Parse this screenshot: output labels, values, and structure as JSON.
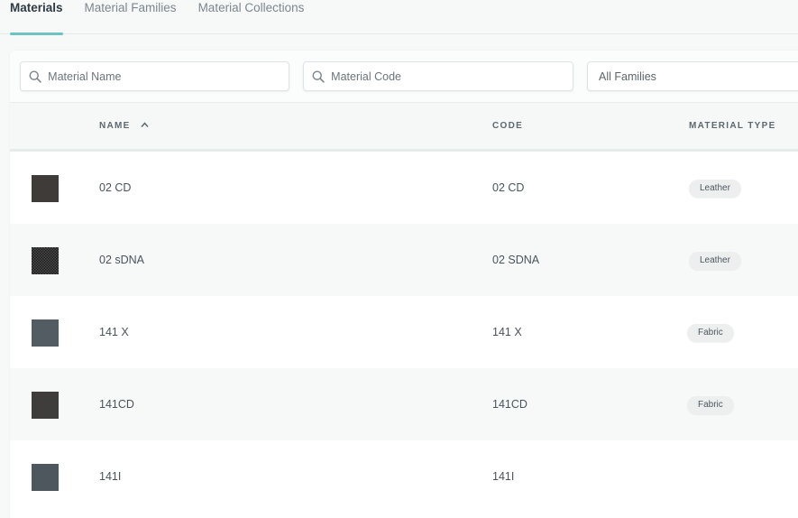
{
  "tabs": [
    {
      "label": "Materials",
      "active": true
    },
    {
      "label": "Material Families",
      "active": false
    },
    {
      "label": "Material Collections",
      "active": false
    }
  ],
  "filters": {
    "name_placeholder": "Material Name",
    "code_placeholder": "Material Code",
    "family_value": "All Families"
  },
  "columns": {
    "name": "NAME",
    "code": "CODE",
    "type": "MATERIAL TYPE",
    "sort_indicator": "chevron-up-icon"
  },
  "rows": [
    {
      "name": "02 CD",
      "code": "02 CD",
      "type": "Leather",
      "swatch": "#3f3b39"
    },
    {
      "name": "02 sDNA",
      "code": "02 SDNA",
      "type": "Leather",
      "swatch": "checker"
    },
    {
      "name": "141 X",
      "code": "141 X",
      "type": "Fabric",
      "swatch": "#545c63"
    },
    {
      "name": "141CD",
      "code": "141CD",
      "type": "Fabric",
      "swatch": "#3f3d3c"
    },
    {
      "name": "141I",
      "code": "141I",
      "type": "",
      "swatch": "#4f575e"
    }
  ],
  "colors": {
    "accent": "#6cc3c1"
  }
}
